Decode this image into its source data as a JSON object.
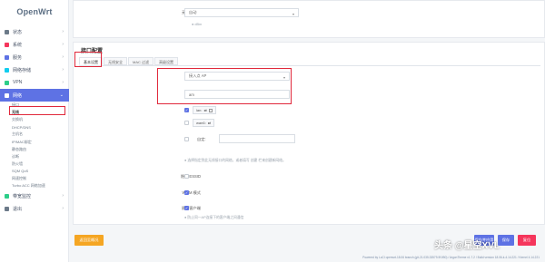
{
  "brand": {
    "name": "OpenWrt"
  },
  "sidebar": {
    "items": [
      {
        "label": "状态",
        "icon": "dashboard-icon",
        "color": "#6c7a89"
      },
      {
        "label": "系统",
        "icon": "gear-icon",
        "color": "#f5365c"
      },
      {
        "label": "服务",
        "icon": "services-icon",
        "color": "#5e72e4"
      },
      {
        "label": "网络存储",
        "icon": "storage-icon",
        "color": "#11cdef"
      },
      {
        "label": "VPN",
        "icon": "vpn-icon",
        "color": "#2dce89"
      },
      {
        "label": "网络",
        "icon": "network-icon",
        "color": "#fff"
      }
    ],
    "network_sub": [
      "接口",
      "无线",
      "交换机",
      "DHCP/DNS",
      "主机名",
      "IP/MAC绑定",
      "静态路由",
      "诊断",
      "防火墙",
      "SQM QoS",
      "网速控制",
      "Turbo ACC 网络加速"
    ],
    "after": [
      {
        "label": "带宽监控",
        "icon": "bandwidth-icon",
        "color": "#2dce89"
      },
      {
        "label": "退出",
        "icon": "logout-icon",
        "color": "#6c7a89"
      }
    ]
  },
  "top": {
    "label": "无线电频率",
    "value": "自动",
    "hint": "dBm"
  },
  "iface": {
    "title": "接口配置",
    "tabs": [
      "基本设置",
      "无线安全",
      "MAC 过滤",
      "高级设置"
    ],
    "mode_label": "模式",
    "mode_value": "接入点 AP",
    "ssid_label": "ESSID",
    "ssid_value": "am",
    "net_label": "网络",
    "nets": [
      {
        "name": "lan:",
        "checked": true
      },
      {
        "name": "wan6:",
        "checked": false
      }
    ],
    "custom_label": "自定",
    "net_hint": "选择指定到此无线接口的网络，或者填写 创建 栏来创建新网络。",
    "hide_ssid_label": "隐藏 ESSID",
    "wmm_label": "WMM 模式",
    "isolate_label": "隔离客户端",
    "isolate_hint": "防止同一AP连接下的客户端之间通信"
  },
  "buttons": {
    "reset": "返回至概况",
    "save_apply": "保存并应用",
    "save": "保存",
    "reset2": "复位"
  },
  "footer": "Powered by LuCI openwrt-18.06 branch (git-21.035.33579-9f1f50) / ArgonTheme v1.7.2 / Build version 18.06-k-4.14.221 / Kernel 4.14.221",
  "watermark": "头条 @星空XVL",
  "colors": {
    "accent": "#5e72e4",
    "highlight": "#e0283b",
    "orange": "#f5a623",
    "red": "#f5365c"
  }
}
